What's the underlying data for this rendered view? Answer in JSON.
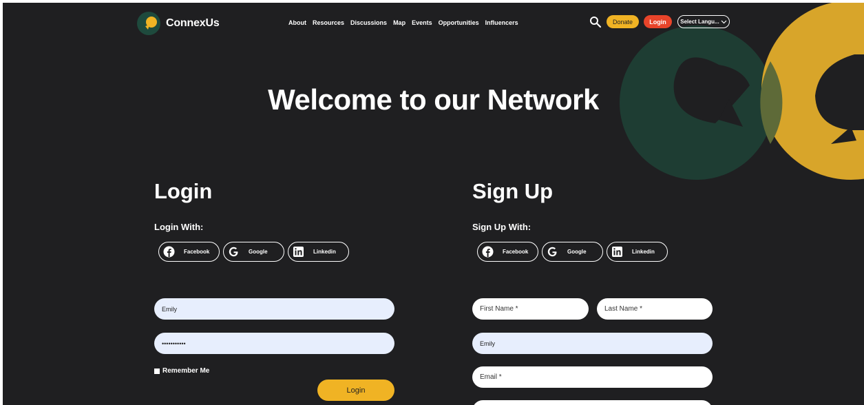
{
  "header": {
    "brand": "ConnexUs",
    "nav": [
      "About",
      "Resources",
      "Discussions",
      "Map",
      "Events",
      "Opportunities",
      "Influencers"
    ],
    "donate_label": "Donate",
    "login_label": "Login",
    "language_label": "Select Langu..."
  },
  "hero": {
    "title": "Welcome to our Network"
  },
  "login": {
    "title": "Login",
    "with_label": "Login With:",
    "social": [
      "Facebook",
      "Google",
      "Linkedin"
    ],
    "username_value": "Emily",
    "password_value": "•••••••••••",
    "remember_label": "Remember Me",
    "submit_label": "Login"
  },
  "signup": {
    "title": "Sign Up",
    "with_label": "Sign Up With:",
    "social": [
      "Facebook",
      "Google",
      "Linkedin"
    ],
    "first_name_placeholder": "First Name *",
    "last_name_placeholder": "Last Name *",
    "username_value": "Emily",
    "email_placeholder": "Email *"
  },
  "colors": {
    "background": "#1f1f21",
    "brand_green": "#1e4a3d",
    "brand_yellow": "#f0b324",
    "accent_red": "#e8442a",
    "field_fill": "#e7eefd"
  },
  "icons": [
    "connexus-logo",
    "search-icon",
    "chevron-down-icon",
    "facebook-icon",
    "google-icon",
    "linkedin-icon"
  ]
}
